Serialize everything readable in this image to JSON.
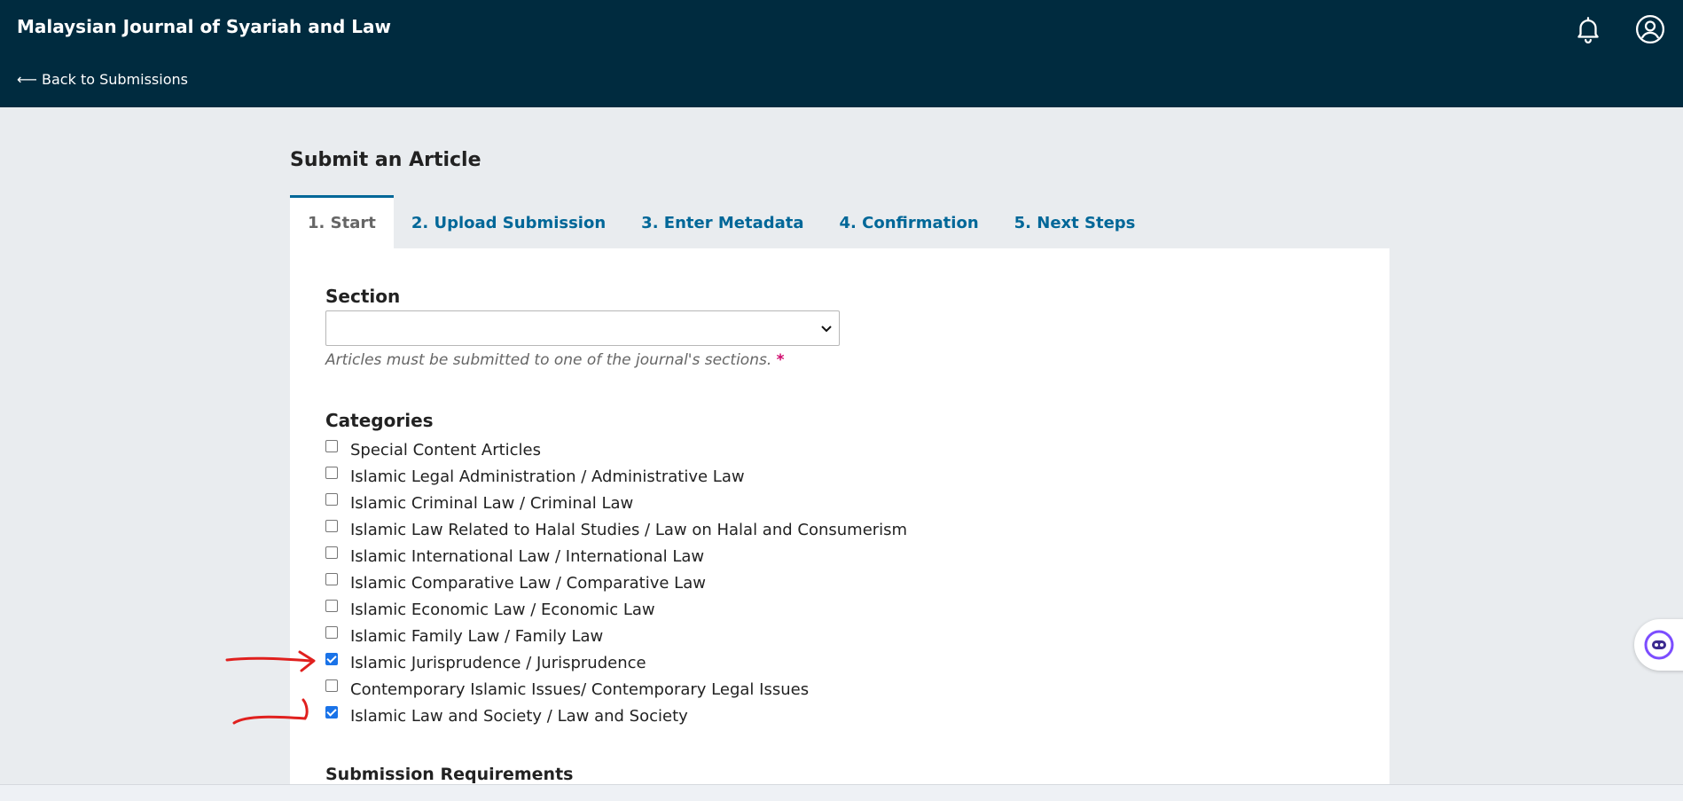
{
  "header": {
    "journal_title": "Malaysian Journal of Syariah and Law",
    "back_link": "⟵ Back to Submissions"
  },
  "page_title": "Submit an Article",
  "tabs": [
    {
      "label": "1. Start",
      "active": true
    },
    {
      "label": "2. Upload Submission",
      "active": false
    },
    {
      "label": "3. Enter Metadata",
      "active": false
    },
    {
      "label": "4. Confirmation",
      "active": false
    },
    {
      "label": "5. Next Steps",
      "active": false
    }
  ],
  "section": {
    "label": "Section",
    "selected_value": "",
    "help": "Articles must be submitted to one of the journal's sections.",
    "required_mark": "*"
  },
  "categories": {
    "label": "Categories",
    "items": [
      {
        "label": "Special Content Articles",
        "checked": false
      },
      {
        "label": "Islamic Legal Administration / Administrative Law",
        "checked": false
      },
      {
        "label": "Islamic Criminal Law / Criminal Law",
        "checked": false
      },
      {
        "label": "Islamic Law Related to Halal Studies / Law on Halal and Consumerism",
        "checked": false
      },
      {
        "label": "Islamic International Law / International Law",
        "checked": false
      },
      {
        "label": "Islamic Comparative Law / Comparative Law",
        "checked": false
      },
      {
        "label": "Islamic Economic Law / Economic Law",
        "checked": false
      },
      {
        "label": "Islamic Family Law / Family Law",
        "checked": false
      },
      {
        "label": "Islamic Jurisprudence / Jurisprudence",
        "checked": true
      },
      {
        "label": "Contemporary Islamic Issues/ Contemporary Legal Issues",
        "checked": false
      },
      {
        "label": "Islamic Law and Society / Law and Society",
        "checked": true
      }
    ]
  },
  "submission_requirements_label": "Submission Requirements",
  "icons": {
    "bell": "bell-icon",
    "user": "user-account-icon",
    "chevron": "chevron-down-icon",
    "assistant": "assistant-icon"
  },
  "colors": {
    "header_bg": "#002b3f",
    "accent": "#006798",
    "checkbox_checked": "#1a73e8",
    "annotation": "#e0201e",
    "required": "#d00a6c"
  }
}
